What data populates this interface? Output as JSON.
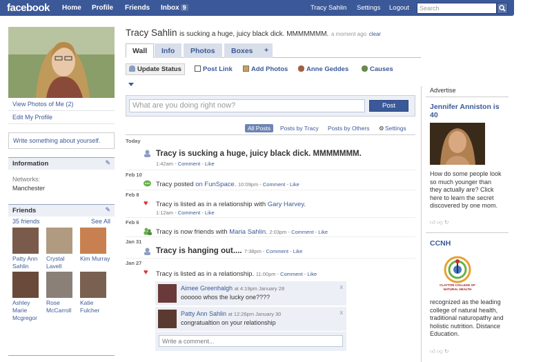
{
  "topnav": {
    "logo": "facebook",
    "home": "Home",
    "profile": "Profile",
    "friends": "Friends",
    "inbox": "Inbox",
    "inbox_count": "9",
    "user": "Tracy Sahlin",
    "settings": "Settings",
    "logout": "Logout",
    "search_placeholder": "Search"
  },
  "left": {
    "view_photos": "View Photos of Me (2)",
    "edit_profile": "Edit My Profile",
    "write_about": "Write something about yourself.",
    "info_title": "Information",
    "networks_label": "Networks:",
    "networks_value": "Manchester",
    "friends_title": "Friends",
    "friends_count": "35 friends",
    "see_all": "See All",
    "friends": [
      {
        "name": "Patty Ann Sahlin",
        "color": "#7a5a4a"
      },
      {
        "name": "Crystal Lavell",
        "color": "#b09a80"
      },
      {
        "name": "Kim Murray",
        "color": "#c88050"
      },
      {
        "name": "Ashley Marie Mcgregor",
        "color": "#6a4a3a"
      },
      {
        "name": "Rose McCarroll",
        "color": "#8a8078"
      },
      {
        "name": "Katie Fulcher",
        "color": "#7a6050"
      }
    ]
  },
  "header": {
    "name": "Tracy Sahlin",
    "status": "is sucking a huge, juicy black dick. MMMMMMM.",
    "time": "a moment ago",
    "clear": "clear"
  },
  "tabs": [
    "Wall",
    "Info",
    "Photos",
    "Boxes",
    "+"
  ],
  "publisher": {
    "update_status": "Update Status",
    "post_link": "Post Link",
    "add_photos": "Add Photos",
    "anne": "Anne Geddes",
    "causes": "Causes",
    "placeholder": "What are you doing right now?",
    "post": "Post"
  },
  "filters": {
    "all": "All Posts",
    "by_tracy": "Posts by Tracy",
    "by_others": "Posts by Others",
    "settings": "Settings"
  },
  "feed": {
    "d1": "Today",
    "i1": "Tracy is sucking a huge, juicy black dick. MMMMMMM.",
    "m1": "1:42am",
    "comment": "Comment",
    "like": "Like",
    "d2": "Feb 10",
    "i2a": "Tracy posted",
    "i2b": "on FunSpace.",
    "m2": "10:09pm",
    "d3": "Feb 8",
    "i3a": "Tracy is listed as in a relationship with",
    "i3b": "Gary Harvey",
    "m3": "1:12am",
    "d4": "Feb 6",
    "i4a": "Tracy is now friends with",
    "i4b": "Maria Sahlin.",
    "m4": "2:03pm",
    "d5": "Jan 31",
    "i5": "Tracy is hanging out....",
    "m5": "7:38pm",
    "d6": "Jan 27",
    "i6": "Tracy is listed as in a relationship.",
    "m6": "11:00pm",
    "c1name": "Aimee Greenhalgh",
    "c1time": "at 4:19pm January 28",
    "c1text": "oooooo whos the lucky one????",
    "c2name": "Patty Ann Sahlin",
    "c2time": "at 12:26pm January 30",
    "c2text": "congratualtion on your relationship",
    "write_comment": "Write a comment..."
  },
  "ads": {
    "advertise": "Advertise",
    "ad1_title": "Jennifer Anniston is 40",
    "ad1_text": "How do some people look so much younger than they actually are? Click here to learn the secret discovered by one mom.",
    "ad2_title": "CCNH",
    "ad2_text": "recognized as the leading college of natural health, traditional naturopathy and holistic nutrition. Distance Education.",
    "ad2_logo_text": "CLAYTON COLLEGE OF NATURAL HEALTH"
  },
  "colors": {
    "brand": "#3b5998",
    "tab_bg": "#d8dfea",
    "box_bg": "#eceff5"
  }
}
